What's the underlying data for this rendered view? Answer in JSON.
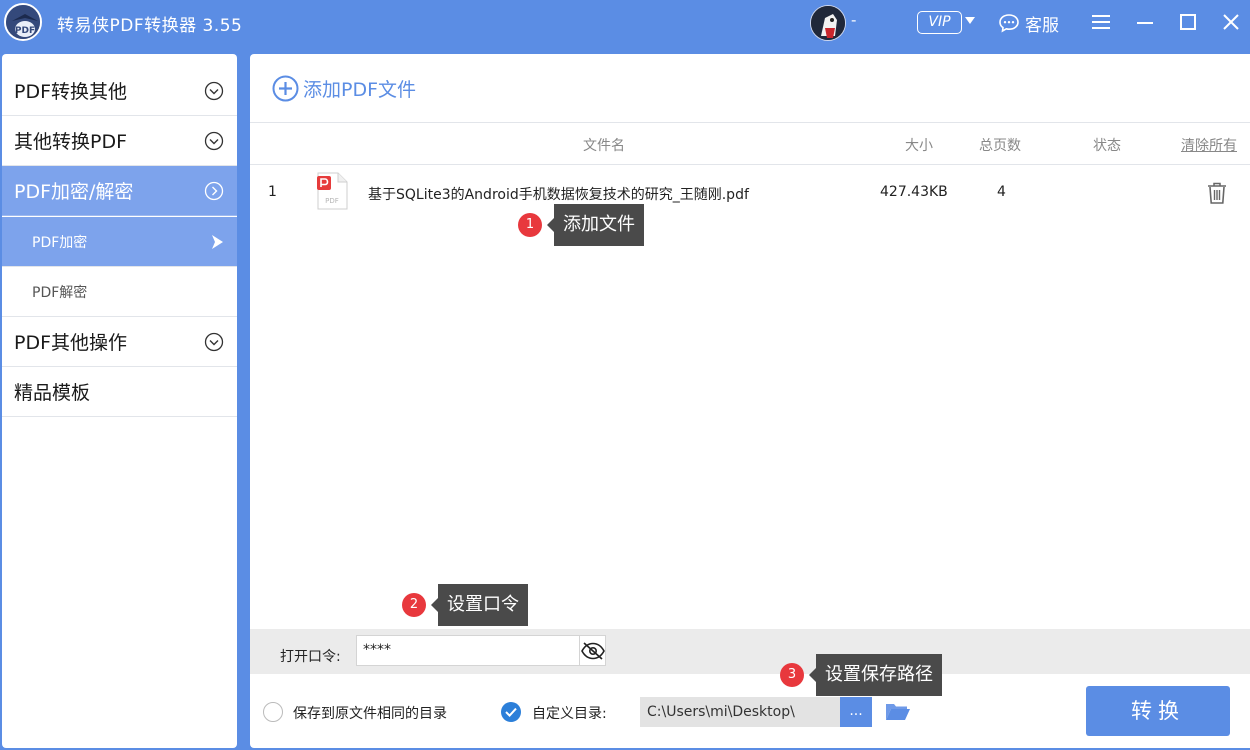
{
  "app": {
    "title": "转易侠PDF转换器 3.55",
    "username": "-",
    "vip_label": "VIP",
    "service_label": "客服"
  },
  "sidebar": {
    "items": [
      {
        "label": "PDF转换其他"
      },
      {
        "label": "其他转换PDF"
      },
      {
        "label": "PDF加密/解密"
      },
      {
        "label": "PDF其他操作"
      },
      {
        "label": "精品模板"
      }
    ],
    "subitems": [
      {
        "label": "PDF加密"
      },
      {
        "label": "PDF解密"
      }
    ]
  },
  "main": {
    "add_label": "添加PDF文件",
    "columns": {
      "name": "文件名",
      "size": "大小",
      "pages": "总页数",
      "status": "状态",
      "clear": "清除所有"
    },
    "files": [
      {
        "index": "1",
        "name": "基于SQLite3的Android手机数据恢复技术的研究_王随刚.pdf",
        "size": "427.43KB",
        "pages": "4",
        "status": ""
      }
    ],
    "file_icon_text": "PDF"
  },
  "tips": [
    {
      "num": "1",
      "label": "添加文件"
    },
    {
      "num": "2",
      "label": "设置口令"
    },
    {
      "num": "3",
      "label": "设置保存路径"
    }
  ],
  "password": {
    "label": "打开口令:",
    "value": "****"
  },
  "output": {
    "same_dir_label": "保存到原文件相同的目录",
    "custom_dir_label": "自定义目录:",
    "path": "C:\\Users\\mi\\Desktop\\",
    "browse_label": "...",
    "convert_label": "转换"
  },
  "colors": {
    "brand": "#5b8de4",
    "sidebar_active": "#7da3ec",
    "badge": "#e8383d",
    "tooltip": "#4a4a4a"
  }
}
